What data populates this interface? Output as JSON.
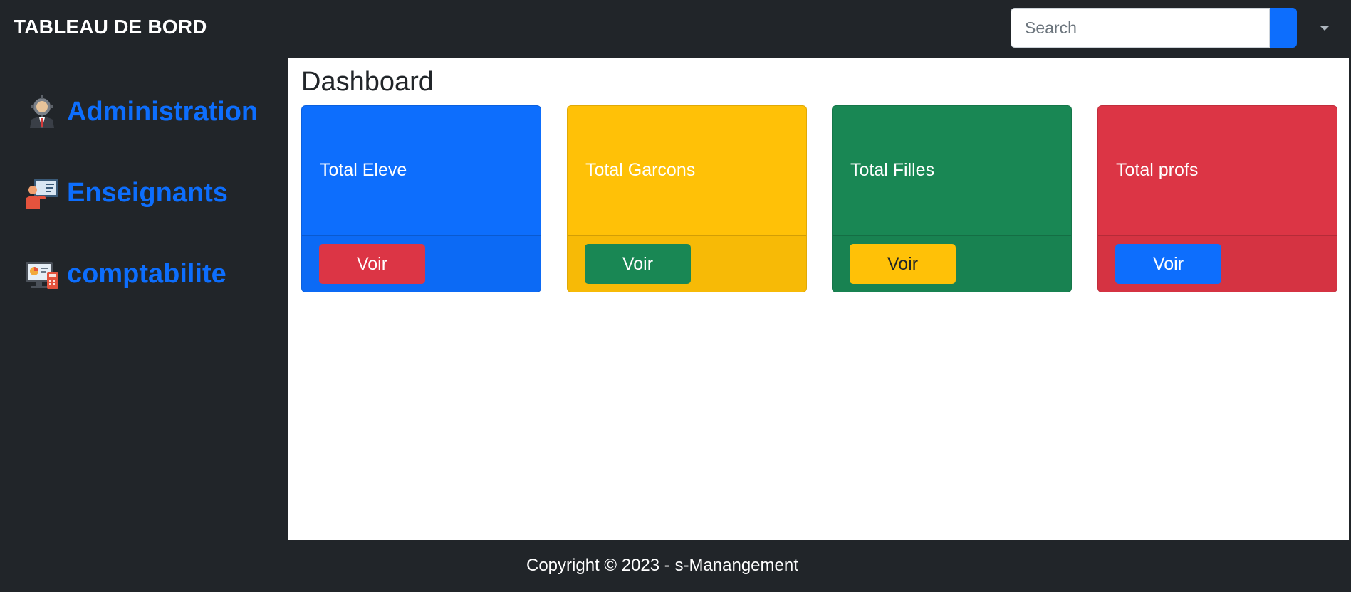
{
  "header": {
    "brand": "TABLEAU DE BORD",
    "search": {
      "placeholder": "Search",
      "value": ""
    }
  },
  "sidebar": {
    "items": [
      {
        "label": "Administration",
        "icon": "administrator-icon"
      },
      {
        "label": "Enseignants",
        "icon": "teacher-icon"
      },
      {
        "label": "comptabilite",
        "icon": "accounting-icon"
      }
    ]
  },
  "main": {
    "title": "Dashboard",
    "cards": [
      {
        "title": "Total Eleve",
        "button": "Voir",
        "bg": "#0d6efd",
        "button_bg": "#dc3545",
        "button_color": "#ffffff",
        "title_color": "#ffffff"
      },
      {
        "title": "Total Garcons",
        "button": "Voir",
        "bg": "#ffc107",
        "button_bg": "#198754",
        "button_color": "#ffffff",
        "title_color": "#ffffff"
      },
      {
        "title": "Total Filles",
        "button": "Voir",
        "bg": "#198754",
        "button_bg": "#ffc107",
        "button_color": "#212529",
        "title_color": "#ffffff"
      },
      {
        "title": "Total profs",
        "button": "Voir",
        "bg": "#dc3545",
        "button_bg": "#0d6efd",
        "button_color": "#ffffff",
        "title_color": "#ffffff"
      }
    ]
  },
  "footer": {
    "text": "Copyright © 2023 - s-Manangement"
  },
  "colors": {
    "dark": "#212529",
    "primary": "#0d6efd"
  }
}
